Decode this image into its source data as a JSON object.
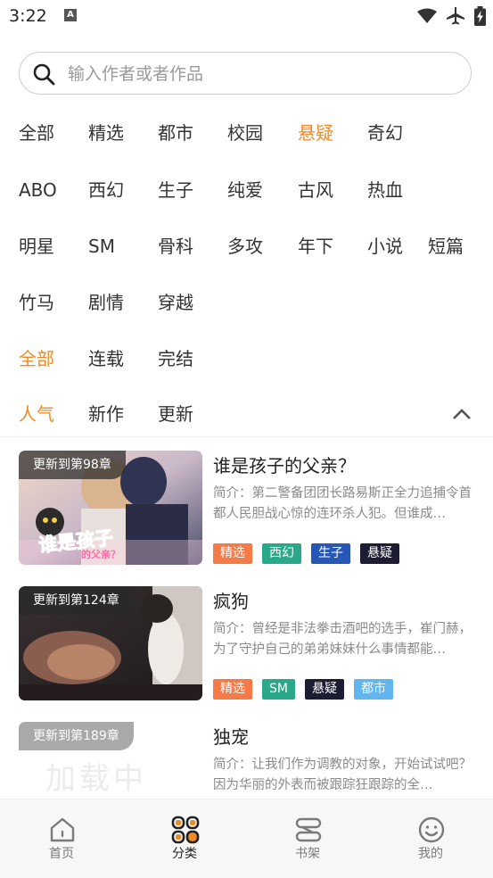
{
  "status_bar": {
    "time": "3:22",
    "a_badge": "A"
  },
  "search": {
    "placeholder": "输入作者或者作品"
  },
  "genres": [
    [
      "全部",
      "精选",
      "都市",
      "校园",
      "悬疑",
      "奇幻"
    ],
    [
      "ABO",
      "西幻",
      "生子",
      "纯爱",
      "古风",
      "热血"
    ],
    [
      "明星",
      "SM",
      "骨科",
      "多攻",
      "年下",
      "小说",
      "短篇"
    ],
    [
      "竹马",
      "剧情",
      "穿越"
    ]
  ],
  "genre_selected": "悬疑",
  "status_filter": {
    "items": [
      "全部",
      "连载",
      "完结"
    ],
    "selected": "全部"
  },
  "sort_filter": {
    "items": [
      "人气",
      "新作",
      "更新"
    ],
    "selected": "人气"
  },
  "books": [
    {
      "badge": "更新到第98章",
      "title": "谁是孩子的父亲？",
      "intro": "简介：第二警备团团长路易斯正全力追捕令首都人民胆战心惊的连环杀人犯。但谁成…",
      "cover_text": "谁是孩子",
      "cover_subtext": "的父亲？",
      "tags": [
        {
          "label": "精选",
          "color": "#f47a48"
        },
        {
          "label": "西幻",
          "color": "#2aa98a"
        },
        {
          "label": "生子",
          "color": "#2757b6"
        },
        {
          "label": "悬疑",
          "color": "#1c1d33"
        }
      ]
    },
    {
      "badge": "更新到第124章",
      "title": "疯狗",
      "intro": "简介：曾经是非法拳击酒吧的选手，崔门赫，为了守护自己的弟弟妹妹什么事情都能…",
      "tags": [
        {
          "label": "精选",
          "color": "#f47a48"
        },
        {
          "label": "SM",
          "color": "#2aa98a"
        },
        {
          "label": "悬疑",
          "color": "#1c1d33"
        },
        {
          "label": "都市",
          "color": "#62b6ef"
        }
      ]
    },
    {
      "badge": "更新到第189章",
      "title": "独宠",
      "intro": "简介：让我们作为调教的对象，开始试试吧？ 因为华丽的外表而被跟踪狂跟踪的全…",
      "cover_loading": "加载中",
      "tags": []
    }
  ],
  "bottom_nav": [
    {
      "label": "首页",
      "icon": "home-icon"
    },
    {
      "label": "分类",
      "icon": "category-icon"
    },
    {
      "label": "书架",
      "icon": "bookshelf-icon"
    },
    {
      "label": "我的",
      "icon": "profile-icon"
    }
  ],
  "nav_active": "分类",
  "colors": {
    "accent": "#f08a24",
    "text": "#333333",
    "muted": "#8a8a8a"
  }
}
